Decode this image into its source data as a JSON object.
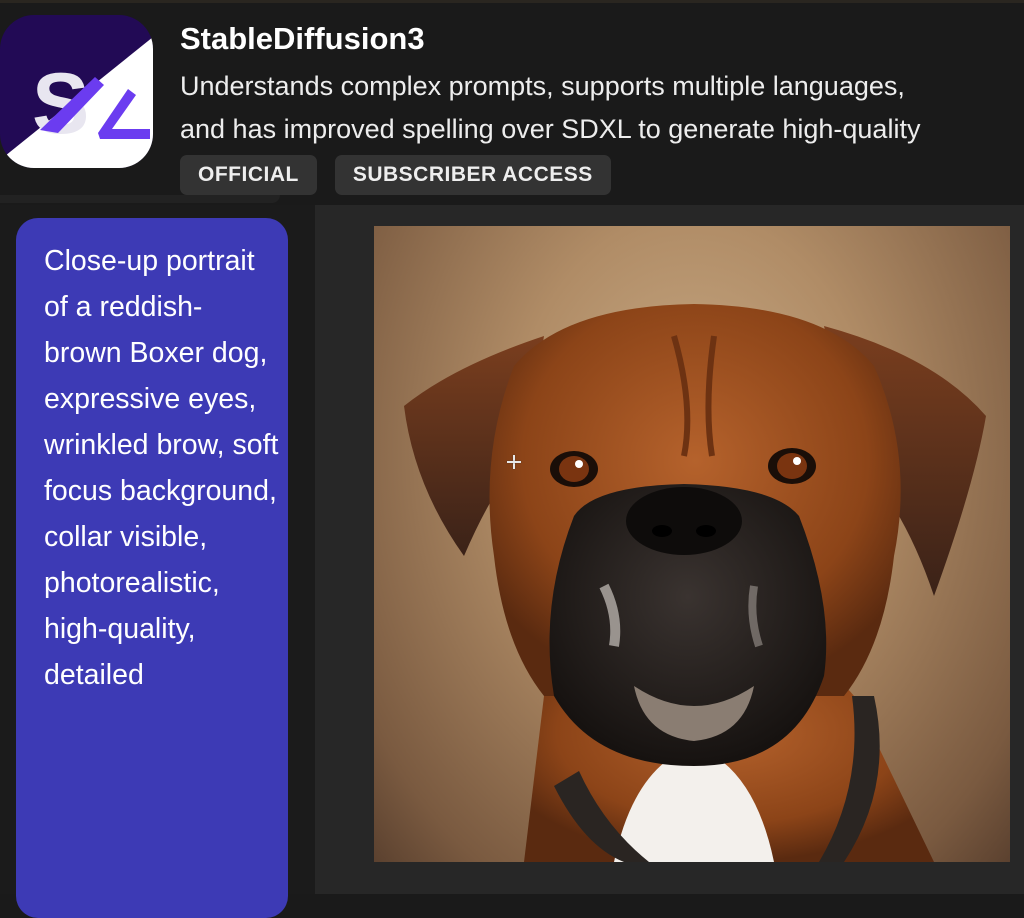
{
  "app": {
    "logo_icon": "stable-diffusion-logo-icon",
    "logo_colors": {
      "dark": "#220a55",
      "light": "#ffffff",
      "accent": "#6b3cf0",
      "letter": "#e8e6f0"
    },
    "title": "StableDiffusion3",
    "description_line1": "Understands complex prompts, supports multiple languages,",
    "description_line2": "and has improved spelling over SDXL to generate high-quality",
    "badges": [
      "OFFICIAL",
      "SUBSCRIBER ACCESS"
    ]
  },
  "conversation": {
    "user_prompt": "Close-up portrait of a reddish-brown Boxer dog, expressive eyes, wrinkled brow, soft focus background, collar visible, photorealistic, high-quality, detailed",
    "prompt_bubble_color": "#3d3ab5",
    "generated_image": {
      "description": "Photorealistic close-up portrait of a reddish-brown Boxer dog with dark muzzle, white chest and collar against a soft-focus tan background",
      "alt": "Generated image of a Boxer dog"
    }
  },
  "cursor": {
    "type": "crosshair-cursor-icon"
  }
}
